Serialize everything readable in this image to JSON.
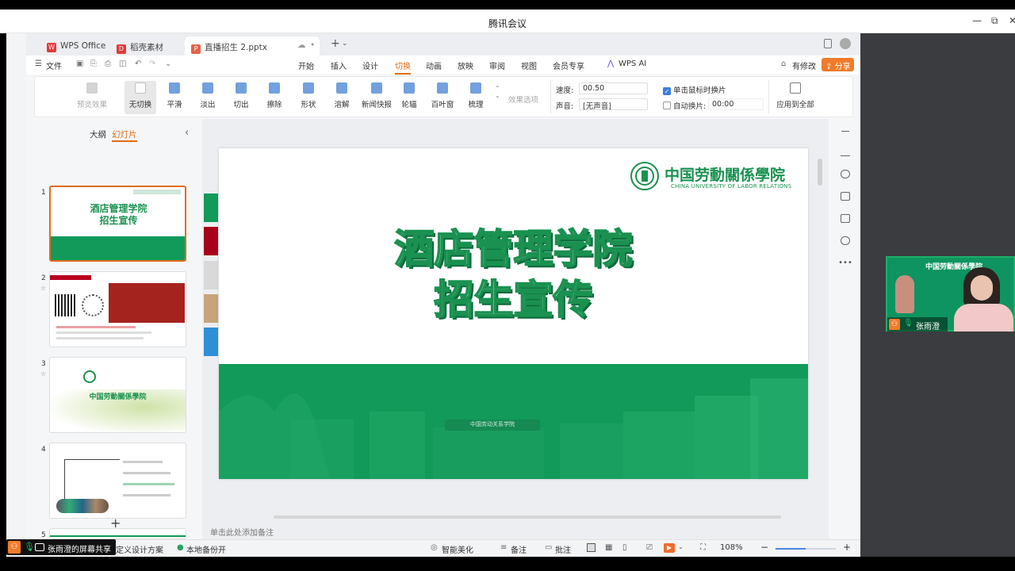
{
  "window": {
    "title": "腾讯会议",
    "minimize": "—",
    "restore": "⧉",
    "close": "✕"
  },
  "tabs": [
    {
      "label": "WPS Office",
      "icon": "wps-logo-icon",
      "color": "#e23b3b"
    },
    {
      "label": "稻壳素材",
      "icon": "docer-icon",
      "color": "#e23b3b"
    },
    {
      "label": "直播招生 2.pptx",
      "icon": "ppt-file-icon",
      "color": "#e8624a"
    }
  ],
  "menubar": {
    "file": "文件",
    "items": [
      "开始",
      "插入",
      "设计",
      "切换",
      "动画",
      "放映",
      "审阅",
      "视图",
      "会员专享"
    ],
    "active": "切换",
    "ai": "WPS AI",
    "modified": "有修改",
    "share": "分享"
  },
  "ribbon": {
    "preview": "预览效果",
    "effects": [
      "无切换",
      "平滑",
      "淡出",
      "切出",
      "擦除",
      "形状",
      "溶解",
      "新闻快报",
      "轮辐",
      "百叶窗",
      "梳理"
    ],
    "selected": "无切换",
    "effect_options": "效果选项",
    "speed_label": "速度:",
    "speed_value": "00.50",
    "sound_label": "声音:",
    "sound_value": "[无声音]",
    "click_switch": "单击鼠标时换片",
    "auto_switch": "自动换片:",
    "auto_time": "00:00",
    "apply_all": "应用到全部"
  },
  "thumbpanel": {
    "outline": "大纲",
    "slides": "幻灯片",
    "collapse": "‹",
    "add": "+",
    "thumb1_line1": "酒店管理学院",
    "thumb1_line2": "招生宣传",
    "thumb3_title": "中国劳動關係學院",
    "numbers": [
      "1",
      "2",
      "3",
      "4",
      "5"
    ]
  },
  "slide": {
    "logo_cn": "中国劳動關係學院",
    "logo_en": "CHINA UNIVERSITY OF LABOR RELATIONS",
    "title_line1": "酒店管理学院",
    "title_line2": "招生宣传",
    "gate_text": "中国劳动关系学院",
    "green": "#119a5a",
    "side_colors": [
      "#119a5a",
      "#a8001c",
      "#d9d9d9",
      "#c7a57a",
      "#2e8fd6"
    ]
  },
  "notes_placeholder": "单击此处添加备注",
  "statusbar": {
    "left_text": "定义设计方案",
    "backup": "本地备份开",
    "beautify": "智能美化",
    "notes": "备注",
    "comments": "批注",
    "zoom": "108%",
    "minus": "−",
    "plus": "+"
  },
  "meeting": {
    "participant_name": "张雨澄",
    "share_label": "张雨澄的屏幕共享",
    "video_logo": "中国劳動關係學院"
  }
}
